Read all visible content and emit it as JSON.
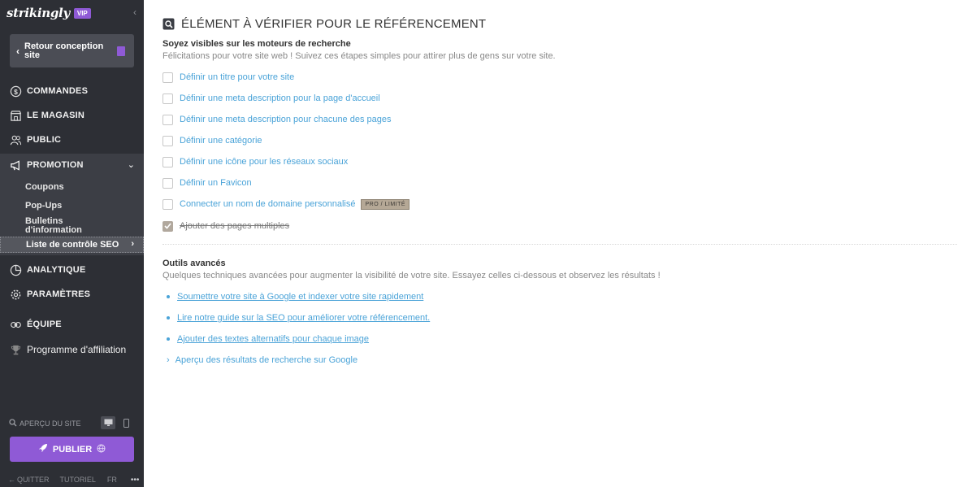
{
  "sidebar": {
    "brand": "strikingly",
    "vip": "VIP",
    "back_button": "Retour conception site",
    "nav": [
      {
        "label": "COMMANDES",
        "icon": "dollar-circle-icon"
      },
      {
        "label": "LE MAGASIN",
        "icon": "store-icon"
      },
      {
        "label": "PUBLIC",
        "icon": "people-icon"
      },
      {
        "label": "PROMOTION",
        "icon": "megaphone-icon"
      },
      {
        "label": "ANALYTIQUE",
        "icon": "pie-chart-icon"
      },
      {
        "label": "PARAMÈTRES",
        "icon": "gear-icon"
      },
      {
        "label": "ÉQUIPE",
        "icon": "team-icon"
      },
      {
        "label": "Programme d'affiliation",
        "icon": "trophy-icon"
      }
    ],
    "promotion_sub": [
      "Coupons",
      "Pop-Ups",
      "Bulletins d'information",
      "Liste de contrôle SEO"
    ],
    "preview_label": "APERÇU DU SITE",
    "publish": "PUBLIER",
    "footer": {
      "quit": "QUITTER",
      "tutorial": "TUTORIEL",
      "lang": "FR",
      "more": "•••"
    }
  },
  "main": {
    "title": "ÉLÉMENT À VÉRIFIER POUR LE RÉFÉRENCEMENT",
    "visible_title": "Soyez visibles sur les moteurs de recherche",
    "visible_desc": "Félicitations pour votre site web ! Suivez ces étapes simples pour attirer plus de gens sur votre site.",
    "checklist": [
      {
        "label": "Définir un titre pour votre site",
        "done": false
      },
      {
        "label": "Définir une meta description pour la page d'accueil",
        "done": false
      },
      {
        "label": "Définir une meta description pour chacune des pages",
        "done": false
      },
      {
        "label": "Définir une catégorie",
        "done": false
      },
      {
        "label": "Définir une icône pour les réseaux sociaux",
        "done": false
      },
      {
        "label": "Définir un Favicon",
        "done": false
      },
      {
        "label": "Connecter un nom de domaine personnalisé",
        "done": false,
        "badge": "PRO / LIMITÉ"
      },
      {
        "label": "Ajouter des pages multiples",
        "done": true
      }
    ],
    "advanced_title": "Outils avancés",
    "advanced_desc": "Quelques techniques avancées pour augmenter la visibilité de votre site. Essayez celles ci-dessous et observez les résultats !",
    "tools": [
      "Soumettre votre site à Google et indexer votre site rapidement",
      "Lire notre guide sur la SEO pour améliorer votre référencement.",
      "Ajouter des textes alternatifs pour chaque image"
    ],
    "google_preview": "Aperçu des résultats de recherche sur Google"
  },
  "colors": {
    "sidebar": "#2d2f35",
    "accent": "#8f5ad6",
    "link": "#4aa3d8"
  }
}
